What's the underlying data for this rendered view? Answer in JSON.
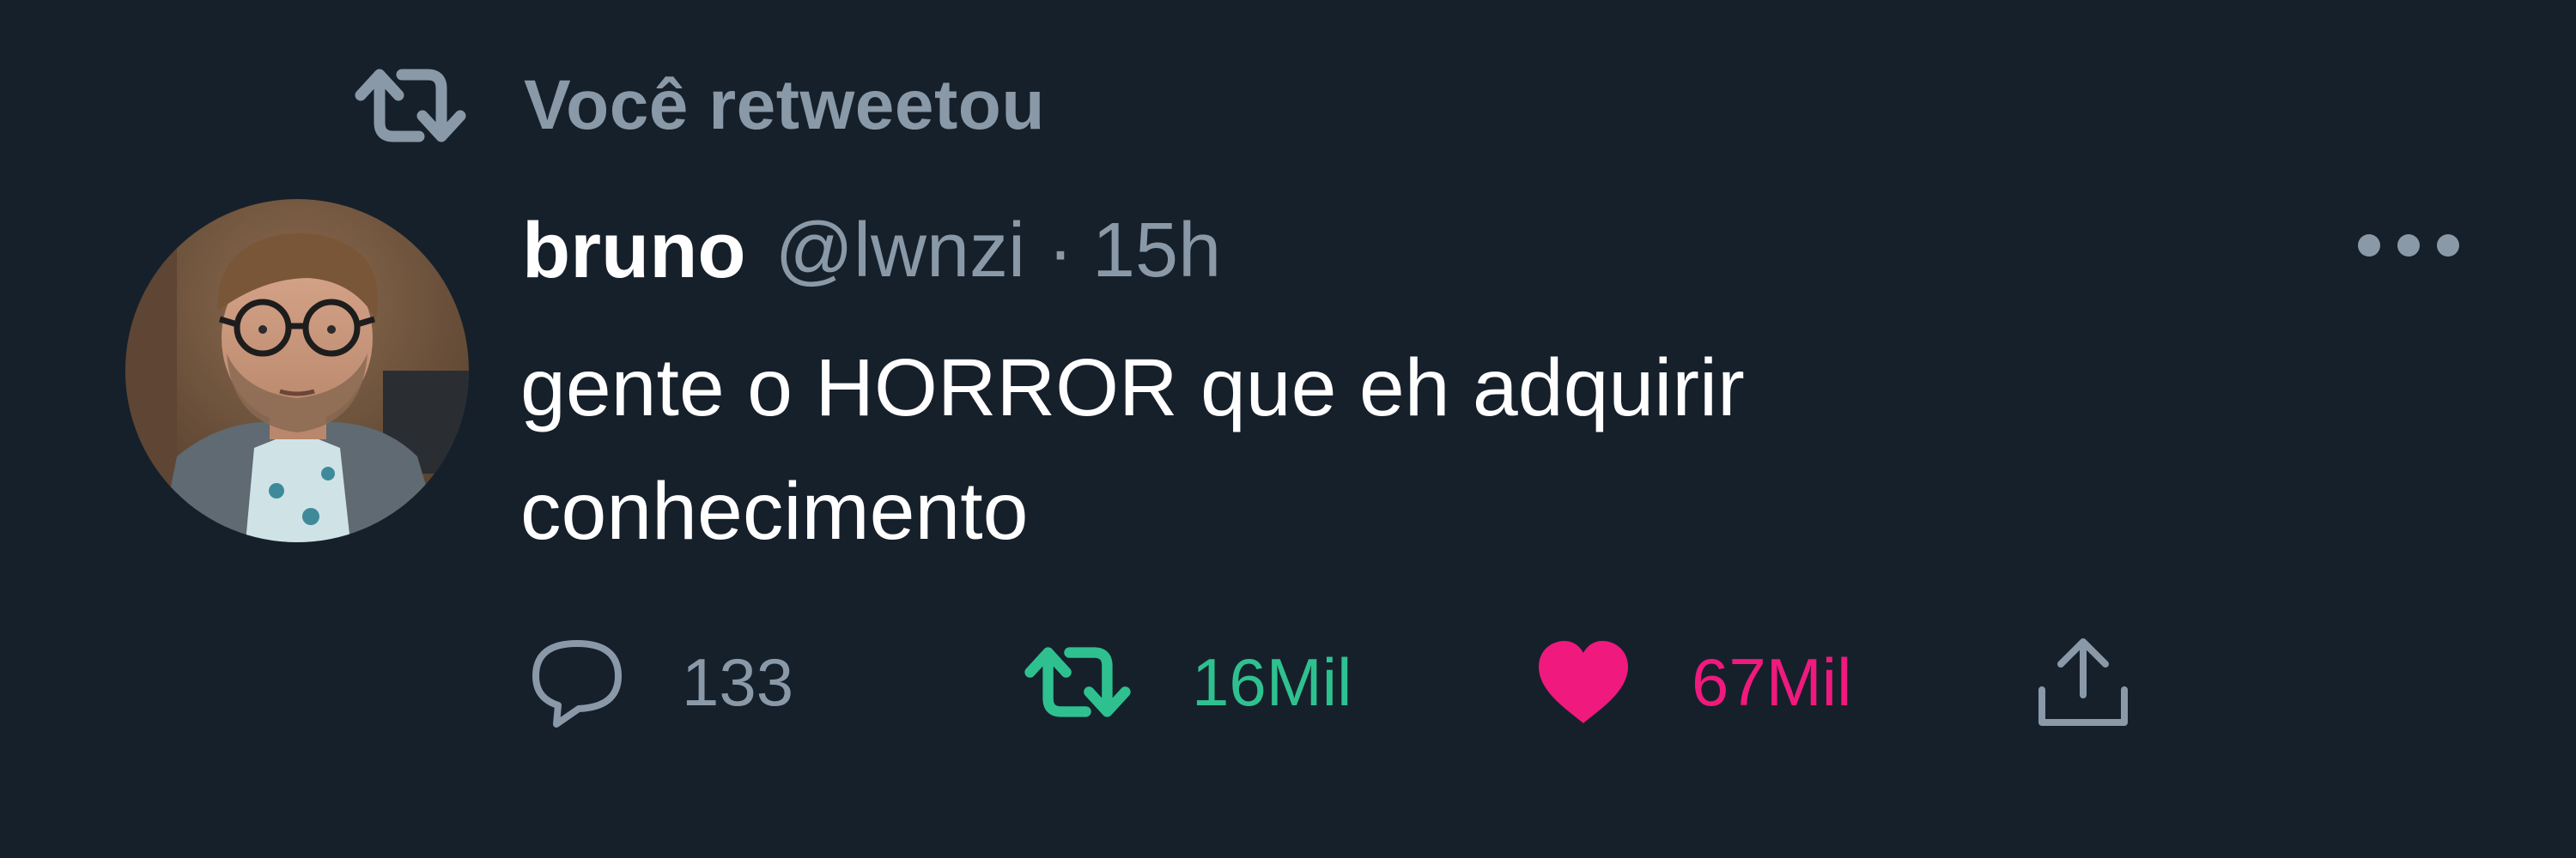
{
  "retweet_header": {
    "label": "Você retweetou",
    "icon": "retweet-icon"
  },
  "tweet": {
    "display_name": "bruno",
    "handle": "@lwnzi",
    "separator": "·",
    "time": "15h",
    "more_icon": "more-icon",
    "text": "gente o HORROR que eh adquirir conhecimento",
    "avatar": "avatar-photo"
  },
  "actions": {
    "reply": {
      "icon": "reply-icon",
      "count": "133"
    },
    "retweet": {
      "icon": "retweet-icon",
      "count": "16Mil",
      "active": true
    },
    "like": {
      "icon": "heart-icon",
      "count": "67Mil",
      "active": true
    },
    "share": {
      "icon": "share-icon"
    }
  },
  "colors": {
    "background": "#16202b",
    "primary_text": "#ffffff",
    "secondary_text": "#8a99a8",
    "retweet_active": "#2ec18f",
    "like_active": "#f0197d"
  }
}
